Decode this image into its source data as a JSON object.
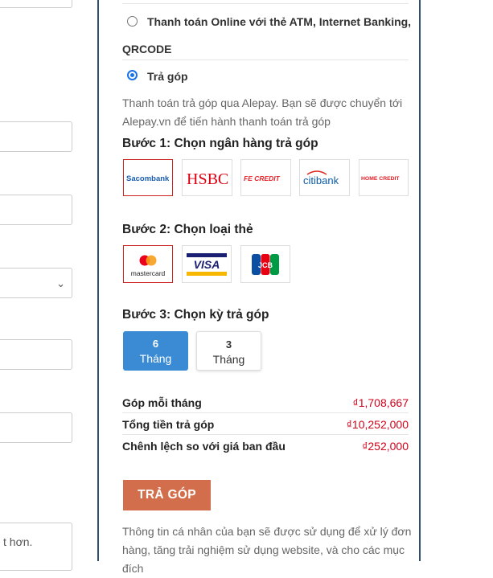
{
  "left_form": {
    "select_chevron": "⌄",
    "cut_text": "t hơn."
  },
  "payment": {
    "online_option": "Thanh toán Online với thẻ ATM, Internet Banking,",
    "online_option_cont": "QRCODE",
    "installment_option": "Trả góp",
    "installment_desc_1": "Thanh toán trả góp qua Alepay. Bạn sẽ được chuyển tới",
    "installment_desc_2": "Alepay.vn để tiến hành thanh toán trả góp"
  },
  "step1": {
    "title": "Bước 1: Chọn ngân hàng trả góp",
    "banks": [
      "Sacombank",
      "HSBC",
      "FE CREDIT",
      "citibank",
      "HOME CREDIT"
    ]
  },
  "step2": {
    "title": "Bước 2: Chọn loại thẻ",
    "cards": [
      "mastercard",
      "VISA",
      "JCB"
    ]
  },
  "step3": {
    "title": "Bước 3: Chọn kỳ trả góp",
    "terms": [
      {
        "num": "6",
        "unit": "Tháng"
      },
      {
        "num": "3",
        "unit": "Tháng"
      }
    ]
  },
  "summary": {
    "monthly_label": "Góp mỗi tháng",
    "monthly_value": "₫1,708,667",
    "total_label": "Tổng tiền trả góp",
    "total_value": "₫10,252,000",
    "diff_label": "Chênh lệch so với giá ban đầu",
    "diff_value": "₫252,000"
  },
  "submit_label": "TRẢ GÓP",
  "privacy_1": "Thông tin cá nhân của bạn sẽ được sử dụng để xử lý đơn",
  "privacy_2": "hàng, tăng trải nghiệm sử dụng website, và cho các mục đích",
  "colors": {
    "panel_border": "#2f4e6f",
    "accent_blue": "#3b8bd4",
    "price_red": "#d0021b",
    "button": "#d26e4b"
  }
}
